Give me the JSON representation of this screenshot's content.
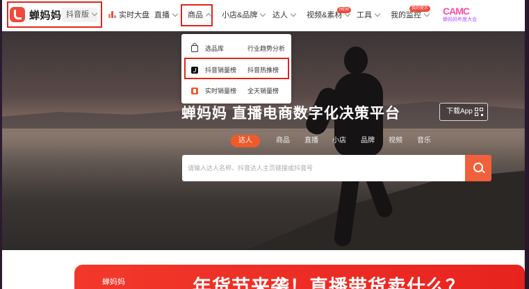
{
  "brand": {
    "name": "蝉妈妈",
    "platform_select": "抖音版"
  },
  "nav": {
    "items": [
      {
        "id": "realtime",
        "label": "实时大盘"
      },
      {
        "id": "live",
        "label": "直播"
      },
      {
        "id": "goods",
        "label": "商品"
      },
      {
        "id": "shop-brand",
        "label": "小店&品牌"
      },
      {
        "id": "influencer",
        "label": "达人"
      },
      {
        "id": "video-material",
        "label": "视频&素材",
        "badge": "NEW"
      },
      {
        "id": "tools",
        "label": "工具"
      },
      {
        "id": "monitor",
        "label": "我的监控",
        "badge": "我的提示"
      }
    ],
    "event_logo": {
      "big": "CAMC",
      "small": "蝉妈妈年度大会"
    }
  },
  "goods_menu": {
    "rows": [
      {
        "icon": "bag-icon",
        "left": "选品库",
        "right": "行业趋势分析"
      },
      {
        "icon": "douyin-icon",
        "left": "抖音销量榜",
        "right": "抖音热推榜"
      },
      {
        "icon": "realtime-icon",
        "left": "实时销量榜",
        "right": "全天销量榜"
      }
    ]
  },
  "hero": {
    "title": "蝉妈妈 直播电商数字化决策平台",
    "download_label": "下载App",
    "search_tabs": [
      "达人",
      "商品",
      "直播",
      "小店",
      "品牌",
      "视频",
      "音乐"
    ],
    "active_tab": "达人",
    "search_placeholder": "请输入达人名称、抖音达人主页链接或抖音号"
  },
  "banner": {
    "logo_text": "蝉妈妈",
    "headline": "年货节来袭！直播带货卖什么？"
  },
  "colors": {
    "accent": "#f05a2a",
    "highlight_border": "#e0261b",
    "badge": "#ef4b3c"
  }
}
